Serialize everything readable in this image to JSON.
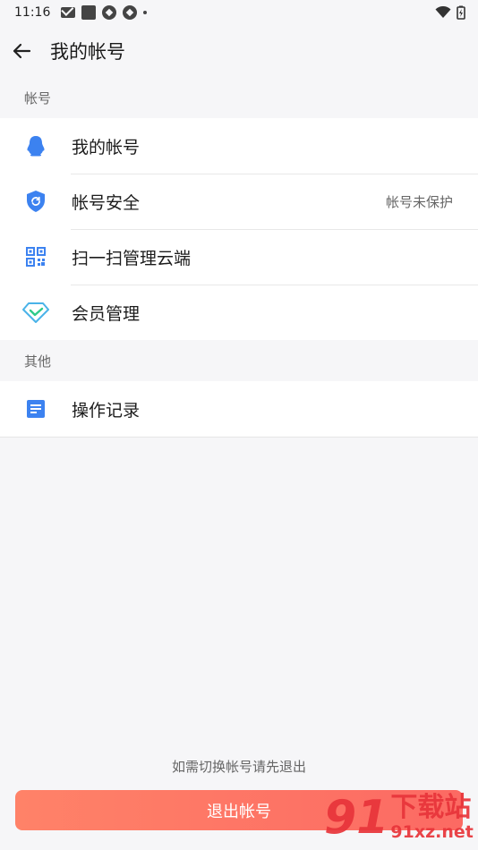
{
  "status_bar": {
    "time": "11:16"
  },
  "header": {
    "title": "我的帐号"
  },
  "sections": [
    {
      "label": "帐号",
      "items": [
        {
          "label": "我的帐号",
          "value": "",
          "icon": "penguin-icon"
        },
        {
          "label": "帐号安全",
          "value": "帐号未保护",
          "icon": "shield-icon"
        },
        {
          "label": "扫一扫管理云端",
          "value": "",
          "icon": "qrcode-icon"
        },
        {
          "label": "会员管理",
          "value": "",
          "icon": "diamond-icon"
        }
      ]
    },
    {
      "label": "其他",
      "items": [
        {
          "label": "操作记录",
          "value": "",
          "icon": "document-icon"
        }
      ]
    }
  ],
  "footer": {
    "hint": "如需切换帐号请先退出",
    "logout_label": "退出帐号"
  },
  "watermark": {
    "number": "91",
    "cn": "下载站",
    "en": "91xz.net"
  },
  "colors": {
    "accent_blue": "#3c82f0",
    "logout_start": "#ff8268",
    "logout_end": "#fc6a63"
  }
}
